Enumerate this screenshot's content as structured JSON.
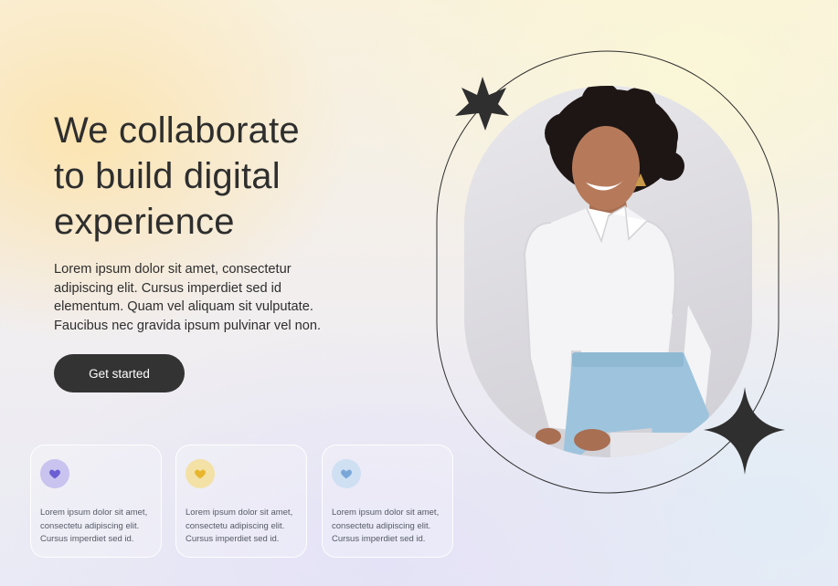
{
  "hero": {
    "headline_line1": "We collaborate",
    "headline_line2": "to build digital",
    "headline_line3": "experience",
    "description": "Lorem ipsum dolor sit amet, consectetur adipiscing elit. Cursus imperdiet sed id elementum. Quam vel aliquam sit vulputate. Faucibus nec gravida ipsum pulvinar vel non.",
    "cta_label": "Get started"
  },
  "cards": [
    {
      "icon": "heart-icon",
      "icon_color": "#6c5fd3",
      "badge_color": "#c9c3ef",
      "text": "Lorem ipsum dolor sit amet, consectetu adipiscing elit. Cursus imperdiet sed id."
    },
    {
      "icon": "heart-icon",
      "icon_color": "#e8b62c",
      "badge_color": "#f3e1a6",
      "text": "Lorem ipsum dolor sit amet, consectetu adipiscing elit. Cursus imperdiet sed id."
    },
    {
      "icon": "heart-icon",
      "icon_color": "#7aa7d8",
      "badge_color": "#cfe0f3",
      "text": "Lorem ipsum dolor sit amet, consectetu adipiscing elit. Cursus imperdiet sed id."
    }
  ],
  "decorations": {
    "star_color": "#2f2f2f",
    "outline_color": "#2f2f2f",
    "icons": [
      "sparkle-star-icon",
      "four-point-star-icon"
    ]
  }
}
